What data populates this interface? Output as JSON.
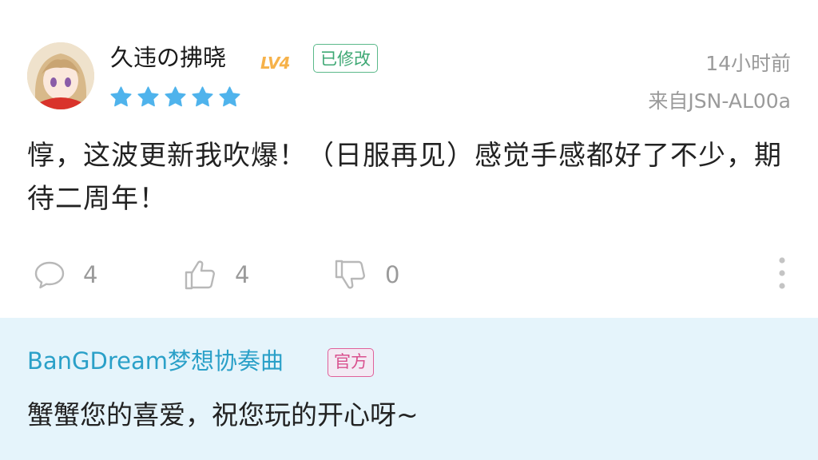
{
  "review": {
    "username": "久违の拂晓",
    "level_badge": "LV4",
    "edited_tag": "已修改",
    "rating_stars": 5,
    "time": "14小时前",
    "device": "来自JSN-AL00a",
    "text": "惇，这波更新我吹爆！（日服再见）感觉手感都好了不少，期待二周年！",
    "comment_count": "4",
    "like_count": "4",
    "dislike_count": "0",
    "icons": {
      "comment": "comment-bubble-icon",
      "like": "thumbs-up-icon",
      "dislike": "thumbs-down-icon",
      "more": "more-vertical-icon",
      "star": "star-icon"
    }
  },
  "reply": {
    "author": "BanGDream梦想协奏曲",
    "official_tag": "官方",
    "text": "蟹蟹您的喜爱，祝您玩的开心呀~"
  },
  "colors": {
    "star": "#4fb3ec",
    "reply_background": "#e5f4fb",
    "reply_author": "#2aa0c8",
    "edited_tag": "#3ea874",
    "official_tag": "#d9508e",
    "level_badge": "#f6b24a",
    "meta_text": "#9a9a9a"
  }
}
